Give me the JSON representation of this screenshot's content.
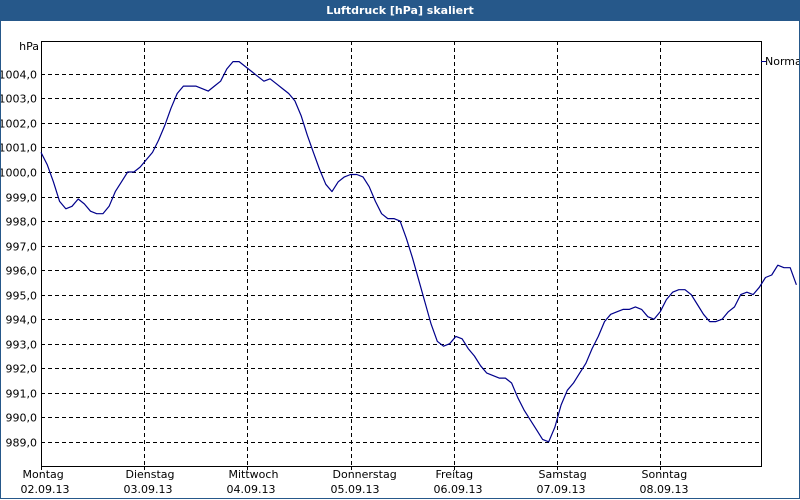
{
  "window": {
    "title": "Luftdruck [hPa] skaliert"
  },
  "chart_data": {
    "type": "line",
    "title": "Luftdruck [hPa] skaliert",
    "ylabel": "hPa",
    "ylim": [
      988.0,
      1005.3
    ],
    "y_ticks": [
      "1004,0",
      "1003,0",
      "1002,0",
      "1001,0",
      "1000,0",
      "999,0",
      "998,0",
      "997,0",
      "996,0",
      "995,0",
      "994,0",
      "993,0",
      "992,0",
      "991,0",
      "990,0",
      "989,0"
    ],
    "x_range_days": [
      0,
      7
    ],
    "x_ticks": [
      {
        "day": "Montag",
        "date": "02.09.13"
      },
      {
        "day": "Dienstag",
        "date": "03.09.13"
      },
      {
        "day": "Mittwoch",
        "date": "04.09.13"
      },
      {
        "day": "Donnerstag",
        "date": "05.09.13"
      },
      {
        "day": "Freitag",
        "date": "06.09.13"
      },
      {
        "day": "Samstag",
        "date": "07.09.13"
      },
      {
        "day": "Sonntag",
        "date": "08.09.13"
      }
    ],
    "grid": true,
    "legend_position": "right",
    "series": [
      {
        "name": "Normal",
        "color": "#00008b",
        "points": [
          [
            0.0,
            1000.8
          ],
          [
            0.06,
            1000.3
          ],
          [
            0.12,
            999.6
          ],
          [
            0.18,
            998.8
          ],
          [
            0.24,
            998.5
          ],
          [
            0.3,
            998.6
          ],
          [
            0.36,
            998.9
          ],
          [
            0.42,
            998.7
          ],
          [
            0.48,
            998.4
          ],
          [
            0.54,
            998.3
          ],
          [
            0.6,
            998.3
          ],
          [
            0.66,
            998.6
          ],
          [
            0.72,
            999.2
          ],
          [
            0.78,
            999.6
          ],
          [
            0.84,
            1000.0
          ],
          [
            0.9,
            1000.0
          ],
          [
            0.96,
            1000.2
          ],
          [
            1.02,
            1000.5
          ],
          [
            1.08,
            1000.8
          ],
          [
            1.14,
            1001.3
          ],
          [
            1.2,
            1001.9
          ],
          [
            1.26,
            1002.6
          ],
          [
            1.32,
            1003.2
          ],
          [
            1.38,
            1003.5
          ],
          [
            1.44,
            1003.5
          ],
          [
            1.5,
            1003.5
          ],
          [
            1.56,
            1003.4
          ],
          [
            1.62,
            1003.3
          ],
          [
            1.68,
            1003.5
          ],
          [
            1.74,
            1003.7
          ],
          [
            1.8,
            1004.2
          ],
          [
            1.86,
            1004.5
          ],
          [
            1.92,
            1004.5
          ],
          [
            1.98,
            1004.3
          ],
          [
            2.04,
            1004.1
          ],
          [
            2.1,
            1003.9
          ],
          [
            2.16,
            1003.7
          ],
          [
            2.22,
            1003.8
          ],
          [
            2.28,
            1003.6
          ],
          [
            2.34,
            1003.4
          ],
          [
            2.4,
            1003.2
          ],
          [
            2.46,
            1002.9
          ],
          [
            2.52,
            1002.3
          ],
          [
            2.58,
            1001.5
          ],
          [
            2.64,
            1000.8
          ],
          [
            2.7,
            1000.1
          ],
          [
            2.76,
            999.5
          ],
          [
            2.82,
            999.2
          ],
          [
            2.88,
            999.6
          ],
          [
            2.94,
            999.8
          ],
          [
            3.0,
            999.9
          ],
          [
            3.06,
            999.9
          ],
          [
            3.12,
            999.8
          ],
          [
            3.18,
            999.4
          ],
          [
            3.24,
            998.8
          ],
          [
            3.3,
            998.3
          ],
          [
            3.36,
            998.1
          ],
          [
            3.42,
            998.1
          ],
          [
            3.48,
            998.0
          ],
          [
            3.54,
            997.3
          ],
          [
            3.6,
            996.5
          ],
          [
            3.66,
            995.6
          ],
          [
            3.72,
            994.7
          ],
          [
            3.78,
            993.8
          ],
          [
            3.84,
            993.1
          ],
          [
            3.9,
            992.9
          ],
          [
            3.96,
            993.0
          ],
          [
            4.02,
            993.3
          ],
          [
            4.08,
            993.2
          ],
          [
            4.14,
            992.8
          ],
          [
            4.2,
            992.5
          ],
          [
            4.26,
            992.1
          ],
          [
            4.32,
            991.8
          ],
          [
            4.38,
            991.7
          ],
          [
            4.44,
            991.6
          ],
          [
            4.5,
            991.6
          ],
          [
            4.56,
            991.4
          ],
          [
            4.62,
            990.8
          ],
          [
            4.68,
            990.3
          ],
          [
            4.74,
            989.9
          ],
          [
            4.8,
            989.5
          ],
          [
            4.86,
            989.1
          ],
          [
            4.92,
            989.0
          ],
          [
            4.98,
            989.6
          ],
          [
            5.04,
            990.5
          ],
          [
            5.1,
            991.1
          ],
          [
            5.16,
            991.4
          ],
          [
            5.22,
            991.8
          ],
          [
            5.28,
            992.2
          ],
          [
            5.34,
            992.8
          ],
          [
            5.4,
            993.3
          ],
          [
            5.46,
            993.9
          ],
          [
            5.52,
            994.2
          ],
          [
            5.58,
            994.3
          ],
          [
            5.64,
            994.4
          ],
          [
            5.7,
            994.4
          ],
          [
            5.76,
            994.5
          ],
          [
            5.82,
            994.4
          ],
          [
            5.88,
            994.1
          ],
          [
            5.94,
            994.0
          ],
          [
            6.0,
            994.3
          ],
          [
            6.06,
            994.8
          ],
          [
            6.12,
            995.1
          ],
          [
            6.18,
            995.2
          ],
          [
            6.24,
            995.2
          ],
          [
            6.3,
            995.0
          ],
          [
            6.36,
            994.6
          ],
          [
            6.42,
            994.2
          ],
          [
            6.48,
            993.9
          ],
          [
            6.54,
            993.9
          ],
          [
            6.6,
            994.0
          ],
          [
            6.66,
            994.3
          ],
          [
            6.72,
            994.5
          ],
          [
            6.78,
            995.0
          ],
          [
            6.84,
            995.1
          ],
          [
            6.9,
            995.0
          ],
          [
            6.96,
            995.3
          ],
          [
            7.02,
            995.7
          ],
          [
            7.08,
            995.8
          ],
          [
            7.14,
            996.2
          ],
          [
            7.2,
            996.1
          ],
          [
            7.26,
            996.1
          ],
          [
            7.32,
            995.4
          ]
        ]
      }
    ]
  }
}
